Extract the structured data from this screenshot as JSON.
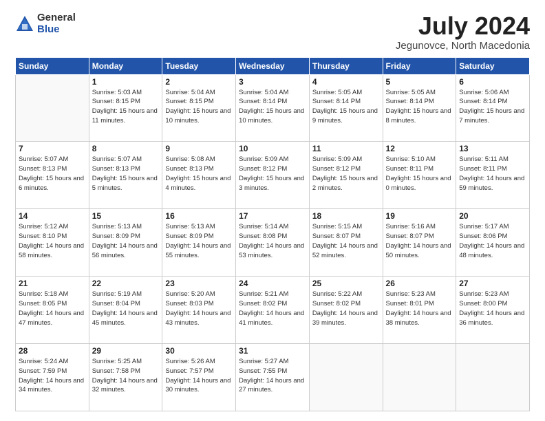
{
  "header": {
    "logo_general": "General",
    "logo_blue": "Blue",
    "month_title": "July 2024",
    "location": "Jegunovce, North Macedonia"
  },
  "days_of_week": [
    "Sunday",
    "Monday",
    "Tuesday",
    "Wednesday",
    "Thursday",
    "Friday",
    "Saturday"
  ],
  "weeks": [
    [
      {
        "day": "",
        "info": ""
      },
      {
        "day": "1",
        "info": "Sunrise: 5:03 AM\nSunset: 8:15 PM\nDaylight: 15 hours\nand 11 minutes."
      },
      {
        "day": "2",
        "info": "Sunrise: 5:04 AM\nSunset: 8:15 PM\nDaylight: 15 hours\nand 10 minutes."
      },
      {
        "day": "3",
        "info": "Sunrise: 5:04 AM\nSunset: 8:14 PM\nDaylight: 15 hours\nand 10 minutes."
      },
      {
        "day": "4",
        "info": "Sunrise: 5:05 AM\nSunset: 8:14 PM\nDaylight: 15 hours\nand 9 minutes."
      },
      {
        "day": "5",
        "info": "Sunrise: 5:05 AM\nSunset: 8:14 PM\nDaylight: 15 hours\nand 8 minutes."
      },
      {
        "day": "6",
        "info": "Sunrise: 5:06 AM\nSunset: 8:14 PM\nDaylight: 15 hours\nand 7 minutes."
      }
    ],
    [
      {
        "day": "7",
        "info": "Sunrise: 5:07 AM\nSunset: 8:13 PM\nDaylight: 15 hours\nand 6 minutes."
      },
      {
        "day": "8",
        "info": "Sunrise: 5:07 AM\nSunset: 8:13 PM\nDaylight: 15 hours\nand 5 minutes."
      },
      {
        "day": "9",
        "info": "Sunrise: 5:08 AM\nSunset: 8:13 PM\nDaylight: 15 hours\nand 4 minutes."
      },
      {
        "day": "10",
        "info": "Sunrise: 5:09 AM\nSunset: 8:12 PM\nDaylight: 15 hours\nand 3 minutes."
      },
      {
        "day": "11",
        "info": "Sunrise: 5:09 AM\nSunset: 8:12 PM\nDaylight: 15 hours\nand 2 minutes."
      },
      {
        "day": "12",
        "info": "Sunrise: 5:10 AM\nSunset: 8:11 PM\nDaylight: 15 hours\nand 0 minutes."
      },
      {
        "day": "13",
        "info": "Sunrise: 5:11 AM\nSunset: 8:11 PM\nDaylight: 14 hours\nand 59 minutes."
      }
    ],
    [
      {
        "day": "14",
        "info": "Sunrise: 5:12 AM\nSunset: 8:10 PM\nDaylight: 14 hours\nand 58 minutes."
      },
      {
        "day": "15",
        "info": "Sunrise: 5:13 AM\nSunset: 8:09 PM\nDaylight: 14 hours\nand 56 minutes."
      },
      {
        "day": "16",
        "info": "Sunrise: 5:13 AM\nSunset: 8:09 PM\nDaylight: 14 hours\nand 55 minutes."
      },
      {
        "day": "17",
        "info": "Sunrise: 5:14 AM\nSunset: 8:08 PM\nDaylight: 14 hours\nand 53 minutes."
      },
      {
        "day": "18",
        "info": "Sunrise: 5:15 AM\nSunset: 8:07 PM\nDaylight: 14 hours\nand 52 minutes."
      },
      {
        "day": "19",
        "info": "Sunrise: 5:16 AM\nSunset: 8:07 PM\nDaylight: 14 hours\nand 50 minutes."
      },
      {
        "day": "20",
        "info": "Sunrise: 5:17 AM\nSunset: 8:06 PM\nDaylight: 14 hours\nand 48 minutes."
      }
    ],
    [
      {
        "day": "21",
        "info": "Sunrise: 5:18 AM\nSunset: 8:05 PM\nDaylight: 14 hours\nand 47 minutes."
      },
      {
        "day": "22",
        "info": "Sunrise: 5:19 AM\nSunset: 8:04 PM\nDaylight: 14 hours\nand 45 minutes."
      },
      {
        "day": "23",
        "info": "Sunrise: 5:20 AM\nSunset: 8:03 PM\nDaylight: 14 hours\nand 43 minutes."
      },
      {
        "day": "24",
        "info": "Sunrise: 5:21 AM\nSunset: 8:02 PM\nDaylight: 14 hours\nand 41 minutes."
      },
      {
        "day": "25",
        "info": "Sunrise: 5:22 AM\nSunset: 8:02 PM\nDaylight: 14 hours\nand 39 minutes."
      },
      {
        "day": "26",
        "info": "Sunrise: 5:23 AM\nSunset: 8:01 PM\nDaylight: 14 hours\nand 38 minutes."
      },
      {
        "day": "27",
        "info": "Sunrise: 5:23 AM\nSunset: 8:00 PM\nDaylight: 14 hours\nand 36 minutes."
      }
    ],
    [
      {
        "day": "28",
        "info": "Sunrise: 5:24 AM\nSunset: 7:59 PM\nDaylight: 14 hours\nand 34 minutes."
      },
      {
        "day": "29",
        "info": "Sunrise: 5:25 AM\nSunset: 7:58 PM\nDaylight: 14 hours\nand 32 minutes."
      },
      {
        "day": "30",
        "info": "Sunrise: 5:26 AM\nSunset: 7:57 PM\nDaylight: 14 hours\nand 30 minutes."
      },
      {
        "day": "31",
        "info": "Sunrise: 5:27 AM\nSunset: 7:55 PM\nDaylight: 14 hours\nand 27 minutes."
      },
      {
        "day": "",
        "info": ""
      },
      {
        "day": "",
        "info": ""
      },
      {
        "day": "",
        "info": ""
      }
    ]
  ]
}
